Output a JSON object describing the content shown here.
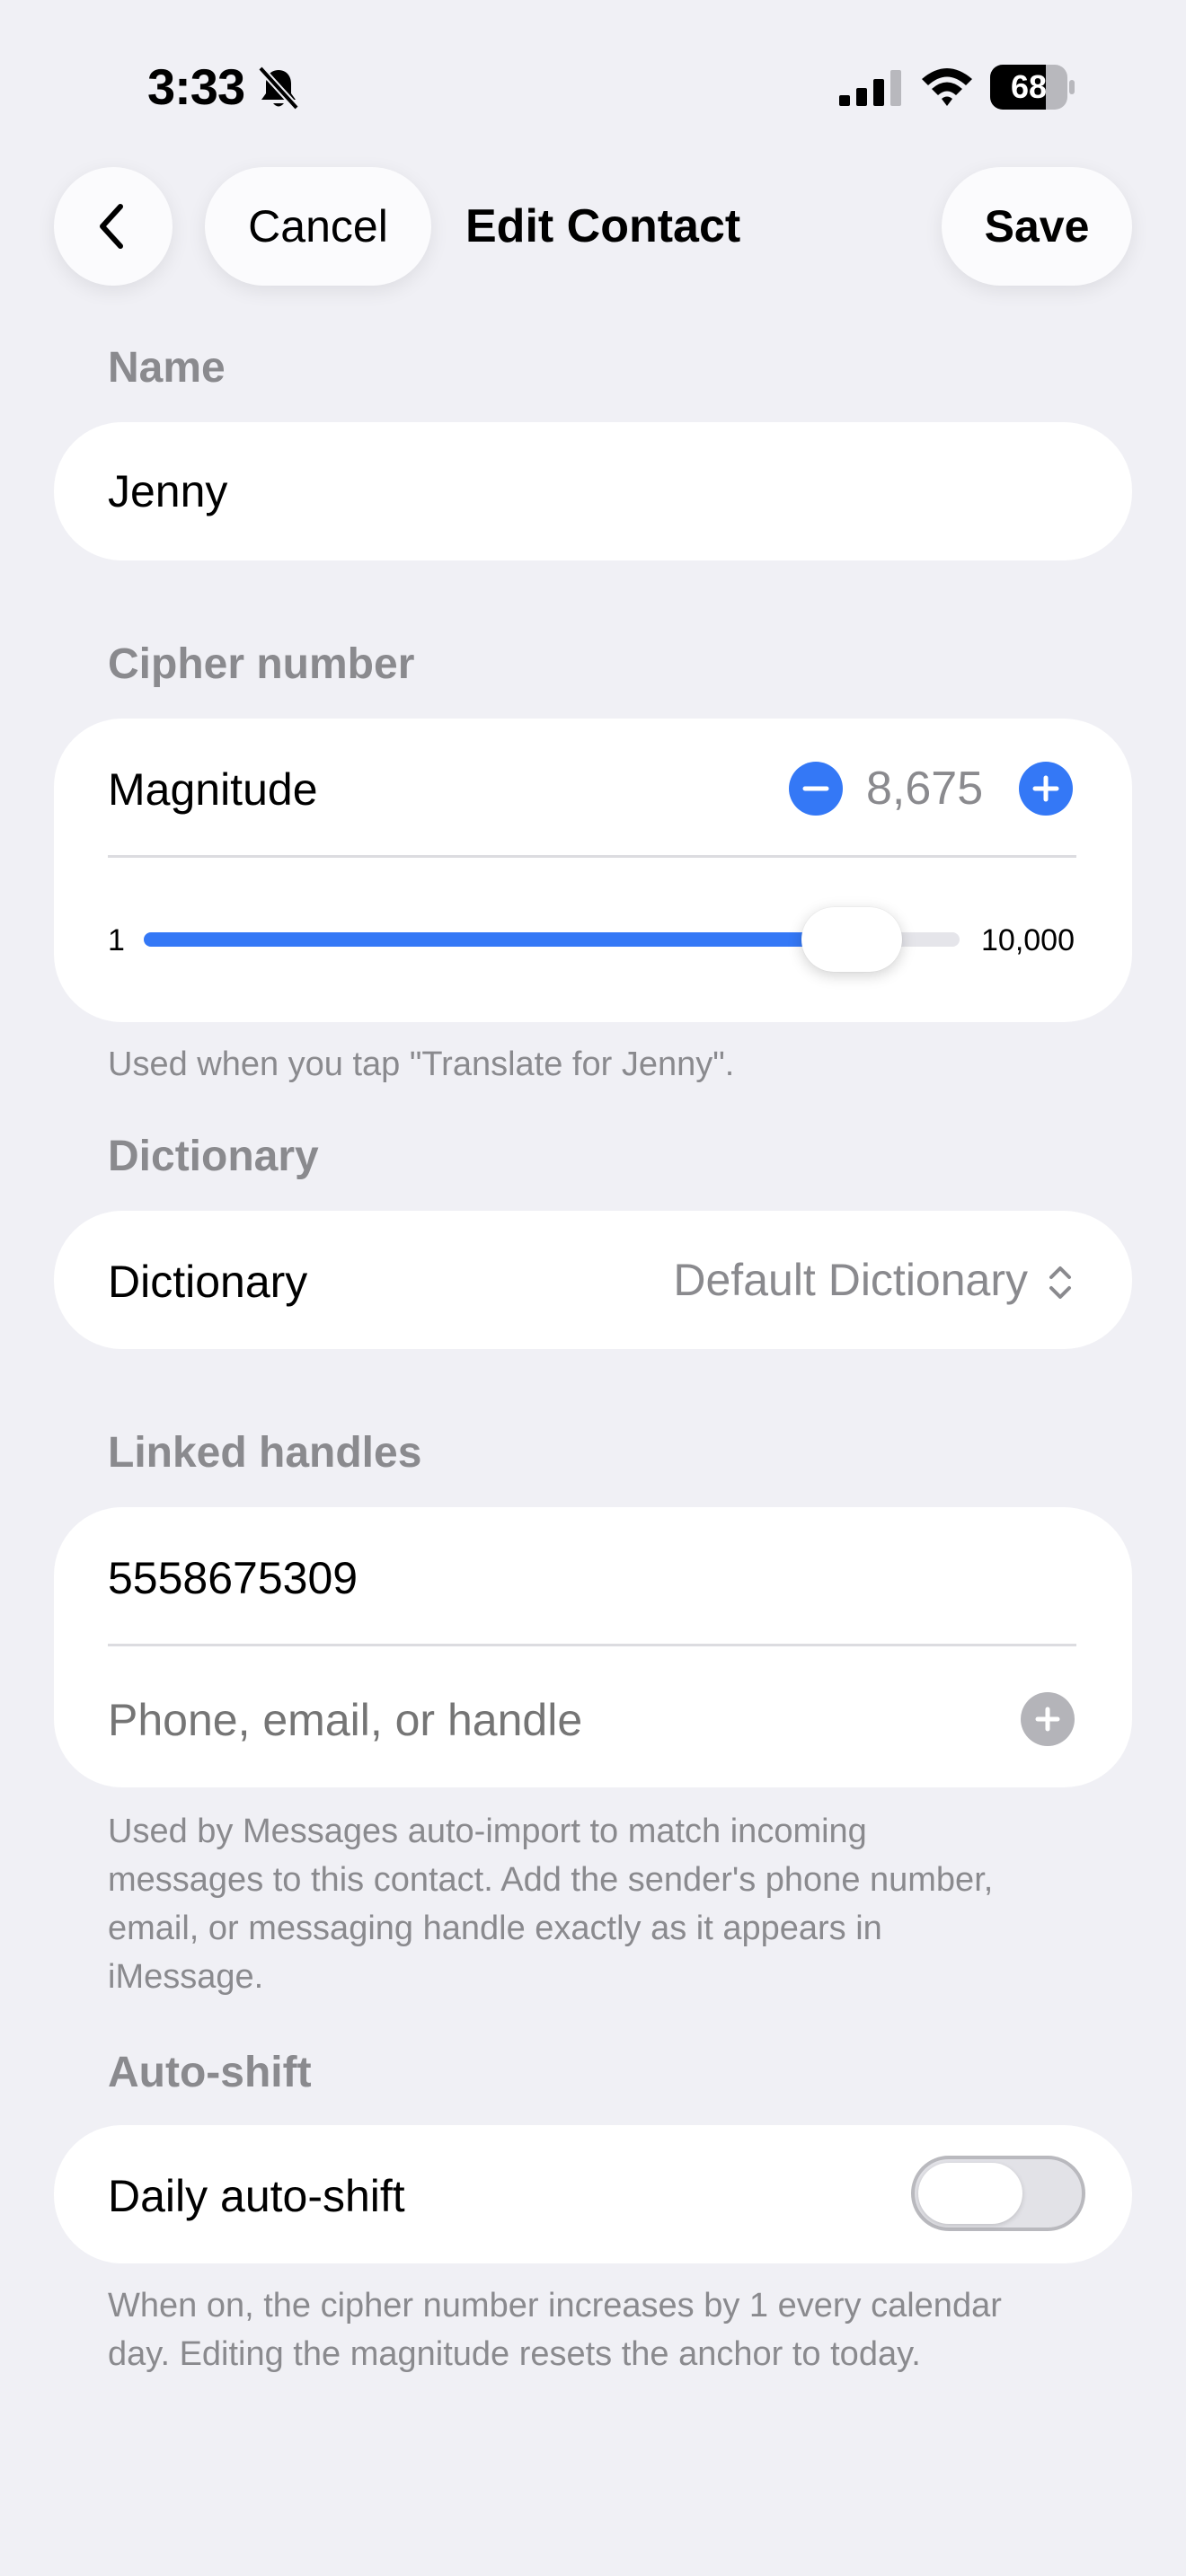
{
  "status": {
    "time": "3:33",
    "battery": "68"
  },
  "nav": {
    "cancel_label": "Cancel",
    "title": "Edit Contact",
    "save_label": "Save"
  },
  "name": {
    "header": "Name",
    "value": "Jenny"
  },
  "cipher": {
    "header": "Cipher number",
    "magnitude_label": "Magnitude",
    "value": "8,675",
    "slider_min": "1",
    "slider_max": "10,000",
    "slider_fraction": 0.8675,
    "footer": "Used when you tap \"Translate for Jenny\"."
  },
  "dictionary": {
    "header": "Dictionary",
    "label": "Dictionary",
    "value": "Default Dictionary"
  },
  "handles": {
    "header": "Linked handles",
    "items": [
      "5558675309"
    ],
    "placeholder": "Phone, email, or handle",
    "footer_lines": [
      "Used by Messages auto-import to match incoming",
      "messages to this contact. Add the sender's phone number,",
      "email, or messaging handle exactly as it appears in",
      "iMessage."
    ]
  },
  "autoshift": {
    "header": "Auto-shift",
    "label": "Daily auto-shift",
    "enabled": false,
    "footer_lines": [
      "When on, the cipher number increases by 1 every calendar",
      "day. Editing the magnitude resets the anchor to today."
    ]
  },
  "colors": {
    "accent": "#3478f6",
    "background": "#f0f0f5",
    "secondary_text": "#8a8a8e"
  }
}
